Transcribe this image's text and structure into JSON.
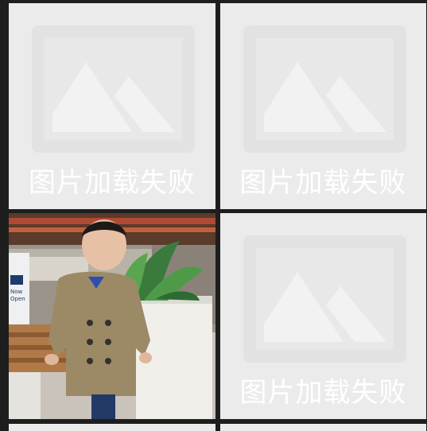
{
  "gallery": {
    "tiles": [
      {
        "status": "failed",
        "message": "图片加载失败",
        "icon": "image-placeholder-icon"
      },
      {
        "status": "failed",
        "message": "图片加载失败",
        "icon": "image-placeholder-icon"
      },
      {
        "status": "loaded",
        "subject": "child in trench coat",
        "sign_text": "Now Open",
        "sign_brand": "gap"
      },
      {
        "status": "failed",
        "message": "图片加载失败",
        "icon": "image-placeholder-icon"
      },
      {
        "status": "loading",
        "message": ""
      },
      {
        "status": "loading",
        "message": ""
      }
    ]
  }
}
